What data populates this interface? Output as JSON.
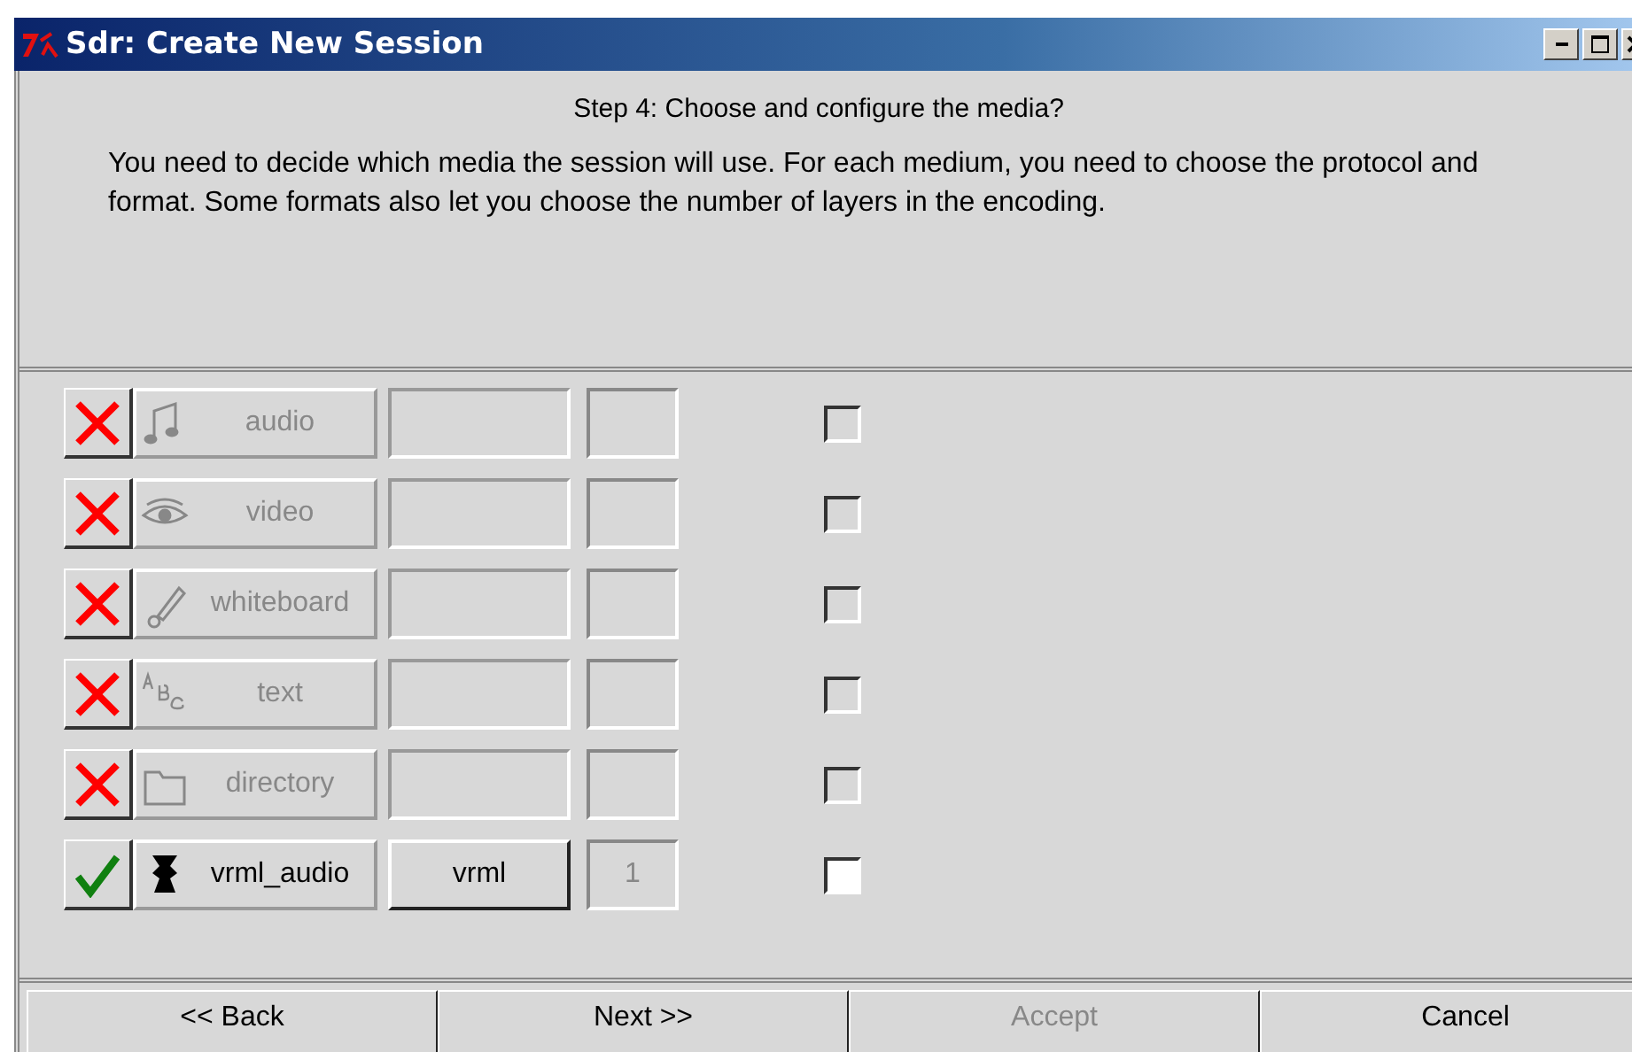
{
  "window": {
    "title": "Sdr: Create New Session"
  },
  "step_title": "Step 4: Choose and configure the media?",
  "description": "You need to decide which media the session will use.  For each medium, you need to choose the protocol and format.  Some formats also let you choose the number of layers in the encoding.",
  "media": [
    {
      "name": "audio",
      "enabled": false,
      "checked": false
    },
    {
      "name": "video",
      "enabled": false,
      "checked": false
    },
    {
      "name": "whiteboard",
      "enabled": false,
      "checked": false
    },
    {
      "name": "text",
      "enabled": false,
      "checked": false
    },
    {
      "name": "directory",
      "enabled": false,
      "checked": false
    },
    {
      "name": "vrml_audio",
      "enabled": true,
      "protocol": "vrml",
      "layers": "1",
      "checked": false
    }
  ],
  "buttons": [
    {
      "label": "<< Back",
      "disabled": false
    },
    {
      "label": "Next >>",
      "disabled": false
    },
    {
      "label": "Accept",
      "disabled": true
    },
    {
      "label": "Cancel",
      "disabled": false
    }
  ]
}
